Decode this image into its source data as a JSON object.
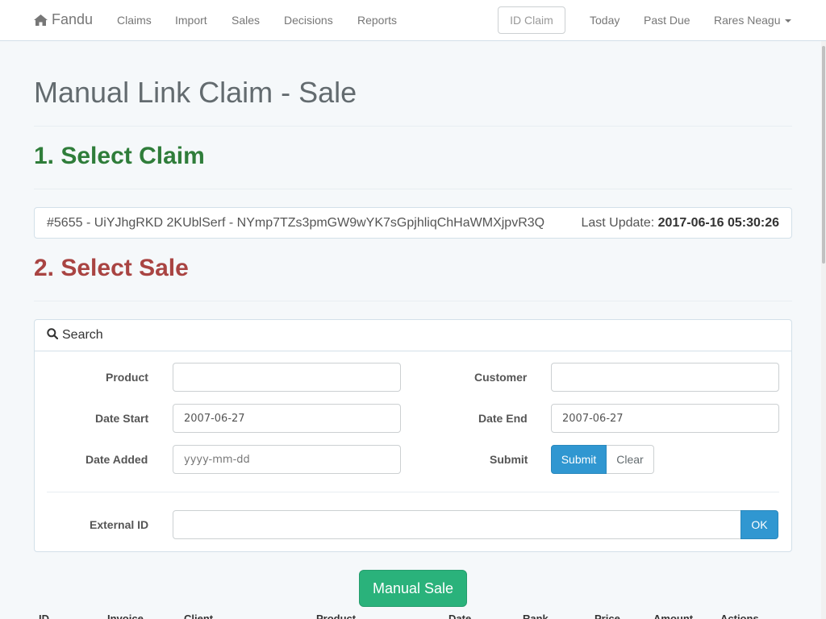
{
  "navbar": {
    "brand": "Fandu",
    "brand_icon": "home-icon",
    "links": [
      "Claims",
      "Import",
      "Sales",
      "Decisions",
      "Reports"
    ],
    "id_claim_placeholder": "ID Claim",
    "right_links": [
      "Today",
      "Past Due"
    ],
    "user": "Rares Neagu"
  },
  "page": {
    "title": "Manual Link Claim - Sale",
    "step1": "1. Select Claim",
    "step2": "2. Select Sale"
  },
  "claim": {
    "text": "#5655 - UiYJhgRKD 2KUblSerf - NYmp7TZs3pmGW9wYK7sGpjhliqChHaWMXjpvR3Q",
    "last_update_label": "Last Update:",
    "last_update_value": "2017-06-16 05:30:26"
  },
  "search": {
    "heading": "Search",
    "product_label": "Product",
    "product_value": "",
    "customer_label": "Customer",
    "customer_value": "",
    "date_start_label": "Date Start",
    "date_start_value": "2007-06-27",
    "date_end_label": "Date End",
    "date_end_value": "2007-06-27",
    "date_added_label": "Date Added",
    "date_added_placeholder": "yyyy-mm-dd",
    "submit_label": "Submit",
    "submit_button": "Submit",
    "clear_button": "Clear",
    "external_id_label": "External ID",
    "external_id_value": "",
    "ok_button": "OK"
  },
  "manual_sale_button": "Manual Sale",
  "table_headers": [
    "ID",
    "Invoice",
    "Client",
    "Product",
    "Date",
    "Rank",
    "Price",
    "Amount",
    "Actions"
  ],
  "colors": {
    "primary": "#3097d1",
    "success": "#2ab27b",
    "step1": "#2f7d3a",
    "step2": "#a94442"
  }
}
